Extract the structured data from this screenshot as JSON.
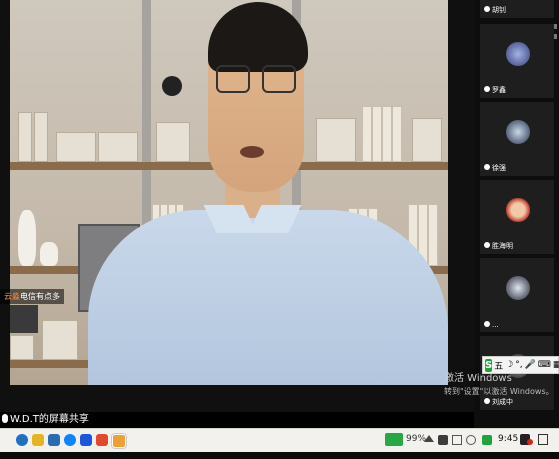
{
  "video": {
    "speaker_name": "云淼",
    "speaker_subtitle": "电信有点多",
    "share_label": "W.D.T的屏幕共享"
  },
  "participants": [
    {
      "name": "胡钊"
    },
    {
      "name": "罗鑫"
    },
    {
      "name": "徐强"
    },
    {
      "name": "胜海明"
    },
    {
      "name": "..."
    },
    {
      "name": "刘成中"
    }
  ],
  "windows_watermark": {
    "line1": "激活 Windows",
    "line2": "转到\"设置\"以激活 Windows。"
  },
  "ime": {
    "logo": "S",
    "mode": "五"
  },
  "taskbar": {
    "battery_percent": "99%",
    "clock": "9:45"
  },
  "colors": {
    "battery": "#27a844",
    "speaker_name": "#ff8a3a"
  }
}
